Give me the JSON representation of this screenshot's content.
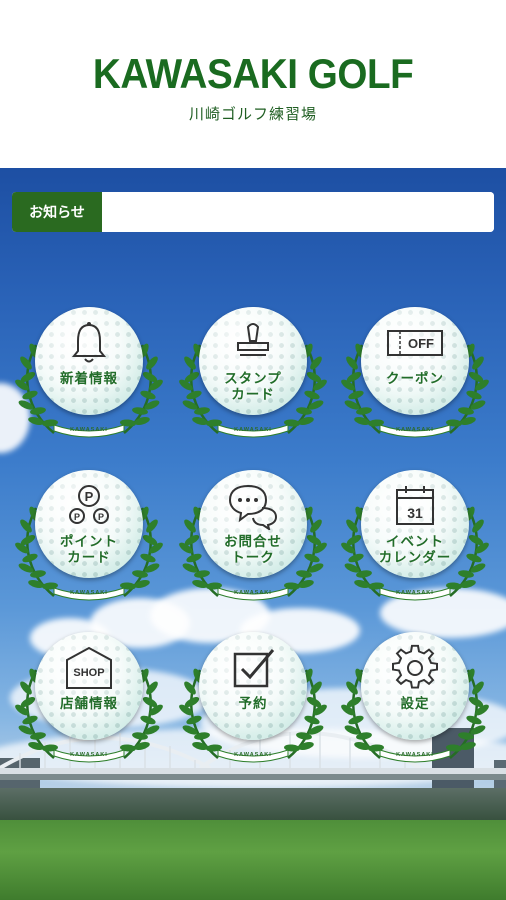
{
  "header": {
    "brand": "KAWASAKI GOLF",
    "subtitle": "川崎ゴルフ練習場"
  },
  "notice": {
    "label": "お知らせ",
    "text": ""
  },
  "menu": [
    {
      "line1": "新着情報",
      "line2": "",
      "icon": "bell-icon",
      "ribbon": "KAWASAKI"
    },
    {
      "line1": "スタンプ",
      "line2": "カード",
      "icon": "stamp-icon",
      "ribbon": "KAWASAKI"
    },
    {
      "line1": "クーポン",
      "line2": "",
      "icon": "coupon-icon",
      "icon_text": "OFF",
      "ribbon": "KAWASAKI"
    },
    {
      "line1": "ポイント",
      "line2": "カード",
      "icon": "point-icon",
      "icon_text": "P",
      "ribbon": "KAWASAKI"
    },
    {
      "line1": "お問合せ",
      "line2": "トーク",
      "icon": "chat-icon",
      "ribbon": "KAWASAKI"
    },
    {
      "line1": "イベント",
      "line2": "カレンダー",
      "icon": "calendar-icon",
      "icon_text": "31",
      "ribbon": "KAWASAKI"
    },
    {
      "line1": "店舗情報",
      "line2": "",
      "icon": "shop-icon",
      "icon_text": "SHOP",
      "ribbon": "KAWASAKI"
    },
    {
      "line1": "予約",
      "line2": "",
      "icon": "checkbox-icon",
      "ribbon": "KAWASAKI"
    },
    {
      "line1": "設定",
      "line2": "",
      "icon": "gear-icon",
      "ribbon": "KAWASAKI"
    }
  ],
  "colors": {
    "brand_green": "#1a6b20",
    "notice_green": "#2a6a20",
    "sky_blue": "#2a63b8"
  }
}
